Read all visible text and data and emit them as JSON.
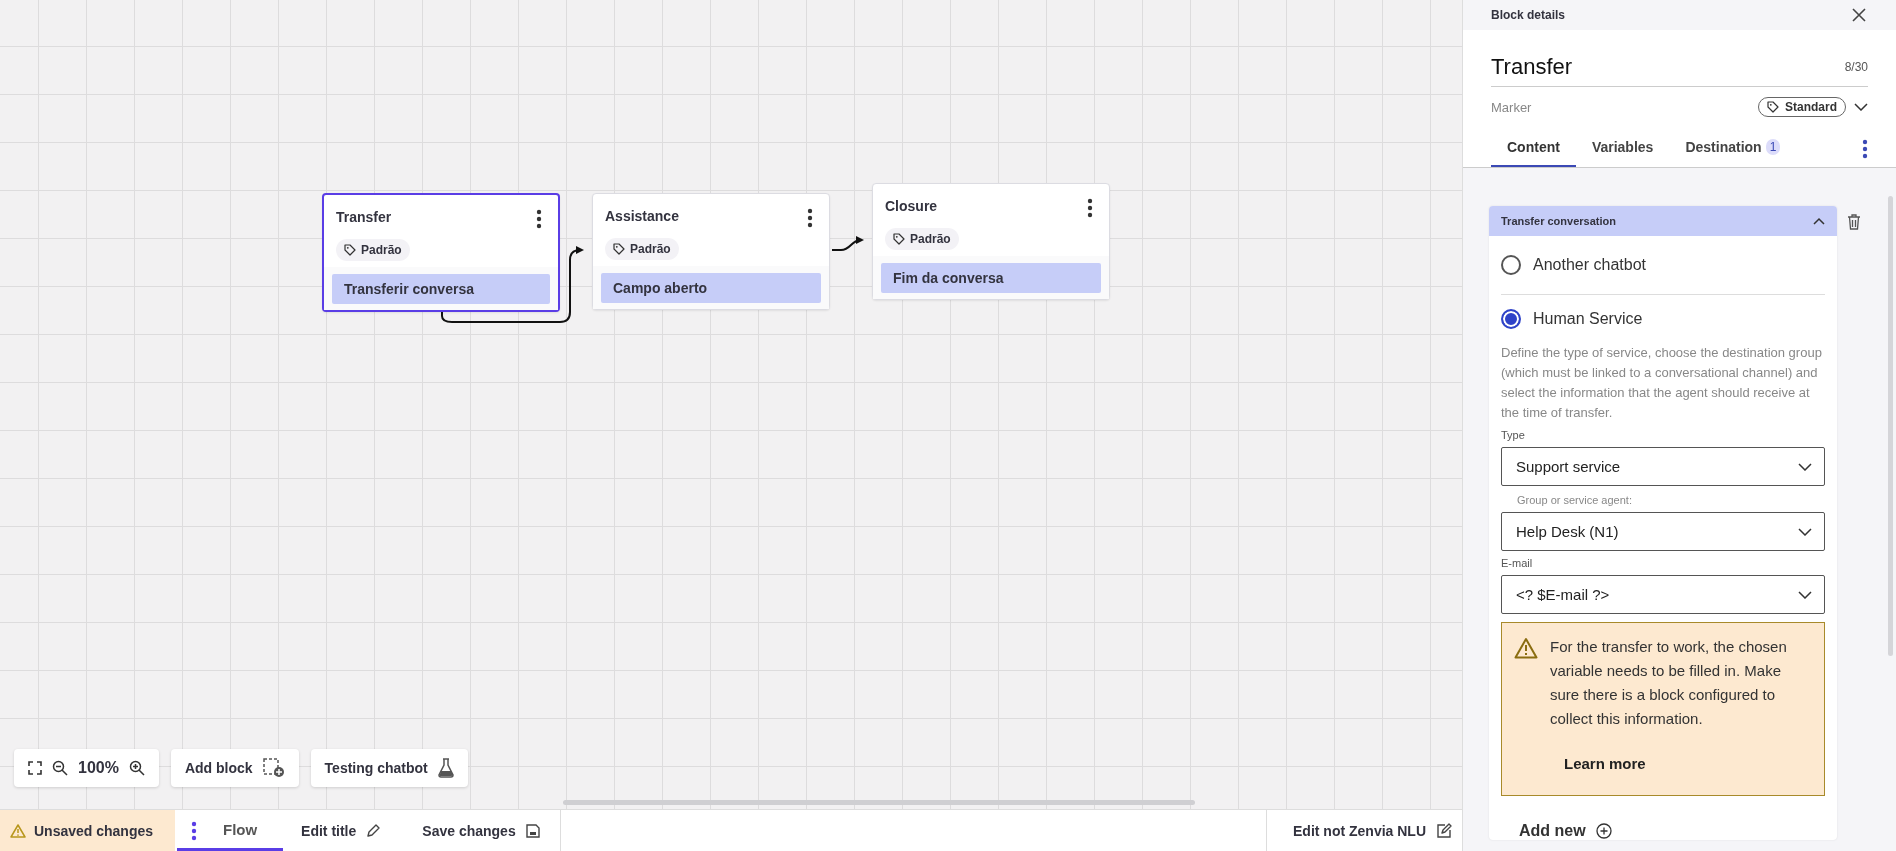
{
  "canvas": {
    "nodes": [
      {
        "title": "Transfer",
        "tag": "Padrão",
        "content": "Transferir conversa",
        "selected": true
      },
      {
        "title": "Assistance",
        "tag": "Padrão",
        "content": "Campo aberto",
        "selected": false
      },
      {
        "title": "Closure",
        "tag": "Padrão",
        "content": "Fim da conversa",
        "selected": false
      }
    ],
    "toolbar": {
      "zoom": "100%",
      "add_block": "Add block",
      "testing": "Testing chatbot"
    }
  },
  "bottom_bar": {
    "status": "Unsaved changes",
    "tabs": [
      {
        "label": "Flow",
        "selected": true
      }
    ],
    "edit_title": "Edit title",
    "save": "Save changes",
    "nlu": "Edit not Zenvia NLU"
  },
  "panel": {
    "header": "Block details",
    "name": "Transfer",
    "counter": "8/30",
    "marker_label": "Marker",
    "marker_value": "Standard",
    "tabs": [
      {
        "label": "Content",
        "selected": true
      },
      {
        "label": "Variables",
        "selected": false
      },
      {
        "label": "Destination",
        "selected": false,
        "badge": "1"
      }
    ],
    "section": {
      "title": "Transfer conversation",
      "expanded": true,
      "options": [
        {
          "label": "Another chatbot",
          "selected": false
        },
        {
          "label": "Human Service",
          "selected": true
        }
      ],
      "description": "Define the type of service, choose the destination group (which must be linked to a conversational channel) and select the information that the agent should receive at the time of transfer.",
      "fields": [
        {
          "label": "Type",
          "value": "Support service"
        },
        {
          "label": "Group or service agent:",
          "value": "Help Desk (N1)"
        },
        {
          "label": "E-mail",
          "value": "<? $E-mail ?>"
        }
      ],
      "warning": {
        "text": "For the transfer to work, the chosen variable needs to be filled in. Make sure there is a block configured to collect this information.",
        "link": "Learn more"
      }
    },
    "add_new": "Add new"
  }
}
